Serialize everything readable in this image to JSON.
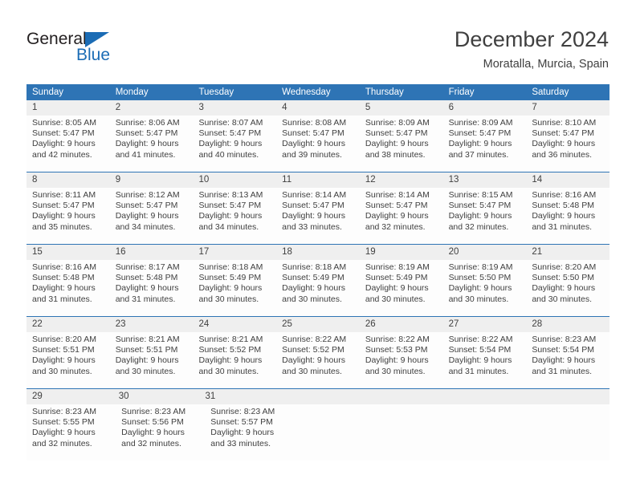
{
  "brand": {
    "name_dark": "General",
    "name_blue": "Blue",
    "accent_color": "#1b6cb5"
  },
  "header": {
    "month_title": "December 2024",
    "location": "Moratalla, Murcia, Spain"
  },
  "calendar": {
    "header_bg": "#2e74b5",
    "daynum_bg": "#efefef",
    "weekday_names": [
      "Sunday",
      "Monday",
      "Tuesday",
      "Wednesday",
      "Thursday",
      "Friday",
      "Saturday"
    ],
    "weeks": [
      {
        "lead_blanks": 0,
        "days": [
          {
            "num": "1",
            "lines": [
              "Sunrise: 8:05 AM",
              "Sunset: 5:47 PM",
              "Daylight: 9 hours",
              "and 42 minutes."
            ]
          },
          {
            "num": "2",
            "lines": [
              "Sunrise: 8:06 AM",
              "Sunset: 5:47 PM",
              "Daylight: 9 hours",
              "and 41 minutes."
            ]
          },
          {
            "num": "3",
            "lines": [
              "Sunrise: 8:07 AM",
              "Sunset: 5:47 PM",
              "Daylight: 9 hours",
              "and 40 minutes."
            ]
          },
          {
            "num": "4",
            "lines": [
              "Sunrise: 8:08 AM",
              "Sunset: 5:47 PM",
              "Daylight: 9 hours",
              "and 39 minutes."
            ]
          },
          {
            "num": "5",
            "lines": [
              "Sunrise: 8:09 AM",
              "Sunset: 5:47 PM",
              "Daylight: 9 hours",
              "and 38 minutes."
            ]
          },
          {
            "num": "6",
            "lines": [
              "Sunrise: 8:09 AM",
              "Sunset: 5:47 PM",
              "Daylight: 9 hours",
              "and 37 minutes."
            ]
          },
          {
            "num": "7",
            "lines": [
              "Sunrise: 8:10 AM",
              "Sunset: 5:47 PM",
              "Daylight: 9 hours",
              "and 36 minutes."
            ]
          }
        ]
      },
      {
        "lead_blanks": 0,
        "days": [
          {
            "num": "8",
            "lines": [
              "Sunrise: 8:11 AM",
              "Sunset: 5:47 PM",
              "Daylight: 9 hours",
              "and 35 minutes."
            ]
          },
          {
            "num": "9",
            "lines": [
              "Sunrise: 8:12 AM",
              "Sunset: 5:47 PM",
              "Daylight: 9 hours",
              "and 34 minutes."
            ]
          },
          {
            "num": "10",
            "lines": [
              "Sunrise: 8:13 AM",
              "Sunset: 5:47 PM",
              "Daylight: 9 hours",
              "and 34 minutes."
            ]
          },
          {
            "num": "11",
            "lines": [
              "Sunrise: 8:14 AM",
              "Sunset: 5:47 PM",
              "Daylight: 9 hours",
              "and 33 minutes."
            ]
          },
          {
            "num": "12",
            "lines": [
              "Sunrise: 8:14 AM",
              "Sunset: 5:47 PM",
              "Daylight: 9 hours",
              "and 32 minutes."
            ]
          },
          {
            "num": "13",
            "lines": [
              "Sunrise: 8:15 AM",
              "Sunset: 5:47 PM",
              "Daylight: 9 hours",
              "and 32 minutes."
            ]
          },
          {
            "num": "14",
            "lines": [
              "Sunrise: 8:16 AM",
              "Sunset: 5:48 PM",
              "Daylight: 9 hours",
              "and 31 minutes."
            ]
          }
        ]
      },
      {
        "lead_blanks": 0,
        "days": [
          {
            "num": "15",
            "lines": [
              "Sunrise: 8:16 AM",
              "Sunset: 5:48 PM",
              "Daylight: 9 hours",
              "and 31 minutes."
            ]
          },
          {
            "num": "16",
            "lines": [
              "Sunrise: 8:17 AM",
              "Sunset: 5:48 PM",
              "Daylight: 9 hours",
              "and 31 minutes."
            ]
          },
          {
            "num": "17",
            "lines": [
              "Sunrise: 8:18 AM",
              "Sunset: 5:49 PM",
              "Daylight: 9 hours",
              "and 30 minutes."
            ]
          },
          {
            "num": "18",
            "lines": [
              "Sunrise: 8:18 AM",
              "Sunset: 5:49 PM",
              "Daylight: 9 hours",
              "and 30 minutes."
            ]
          },
          {
            "num": "19",
            "lines": [
              "Sunrise: 8:19 AM",
              "Sunset: 5:49 PM",
              "Daylight: 9 hours",
              "and 30 minutes."
            ]
          },
          {
            "num": "20",
            "lines": [
              "Sunrise: 8:19 AM",
              "Sunset: 5:50 PM",
              "Daylight: 9 hours",
              "and 30 minutes."
            ]
          },
          {
            "num": "21",
            "lines": [
              "Sunrise: 8:20 AM",
              "Sunset: 5:50 PM",
              "Daylight: 9 hours",
              "and 30 minutes."
            ]
          }
        ]
      },
      {
        "lead_blanks": 0,
        "days": [
          {
            "num": "22",
            "lines": [
              "Sunrise: 8:20 AM",
              "Sunset: 5:51 PM",
              "Daylight: 9 hours",
              "and 30 minutes."
            ]
          },
          {
            "num": "23",
            "lines": [
              "Sunrise: 8:21 AM",
              "Sunset: 5:51 PM",
              "Daylight: 9 hours",
              "and 30 minutes."
            ]
          },
          {
            "num": "24",
            "lines": [
              "Sunrise: 8:21 AM",
              "Sunset: 5:52 PM",
              "Daylight: 9 hours",
              "and 30 minutes."
            ]
          },
          {
            "num": "25",
            "lines": [
              "Sunrise: 8:22 AM",
              "Sunset: 5:52 PM",
              "Daylight: 9 hours",
              "and 30 minutes."
            ]
          },
          {
            "num": "26",
            "lines": [
              "Sunrise: 8:22 AM",
              "Sunset: 5:53 PM",
              "Daylight: 9 hours",
              "and 30 minutes."
            ]
          },
          {
            "num": "27",
            "lines": [
              "Sunrise: 8:22 AM",
              "Sunset: 5:54 PM",
              "Daylight: 9 hours",
              "and 31 minutes."
            ]
          },
          {
            "num": "28",
            "lines": [
              "Sunrise: 8:23 AM",
              "Sunset: 5:54 PM",
              "Daylight: 9 hours",
              "and 31 minutes."
            ]
          }
        ]
      },
      {
        "lead_blanks": 0,
        "days": [
          {
            "num": "29",
            "lines": [
              "Sunrise: 8:23 AM",
              "Sunset: 5:55 PM",
              "Daylight: 9 hours",
              "and 32 minutes."
            ]
          },
          {
            "num": "30",
            "lines": [
              "Sunrise: 8:23 AM",
              "Sunset: 5:56 PM",
              "Daylight: 9 hours",
              "and 32 minutes."
            ]
          },
          {
            "num": "31",
            "lines": [
              "Sunrise: 8:23 AM",
              "Sunset: 5:57 PM",
              "Daylight: 9 hours",
              "and 33 minutes."
            ]
          }
        ]
      }
    ]
  }
}
